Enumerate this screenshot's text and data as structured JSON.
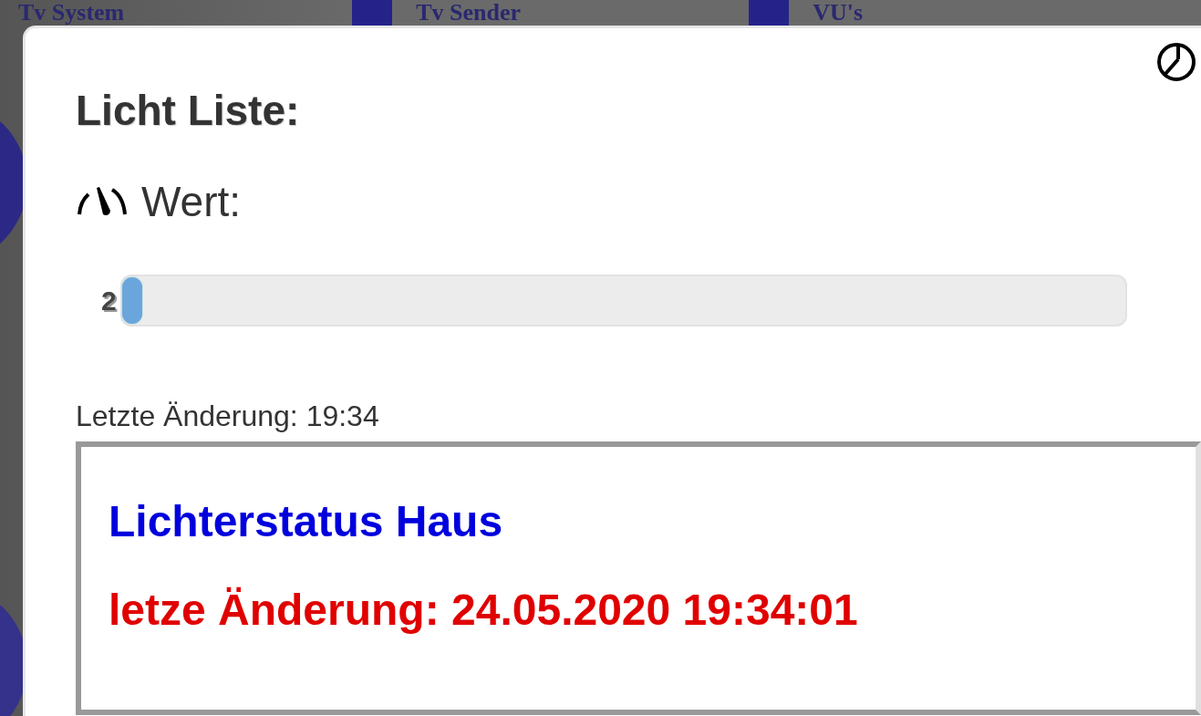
{
  "background_tabs": [
    {
      "label": "Tv System"
    },
    {
      "label": "Tv Sender"
    },
    {
      "label": "VU's"
    }
  ],
  "dialog": {
    "title": "Licht Liste:",
    "value_label": "Wert:",
    "slider": {
      "reading": "2",
      "level": 0
    },
    "last_change": "Letzte Änderung: 19:34",
    "frame": {
      "heading": "Lichterstatus Haus",
      "timestamp": "letze Änderung: 24.05.2020 19:34:01"
    }
  }
}
